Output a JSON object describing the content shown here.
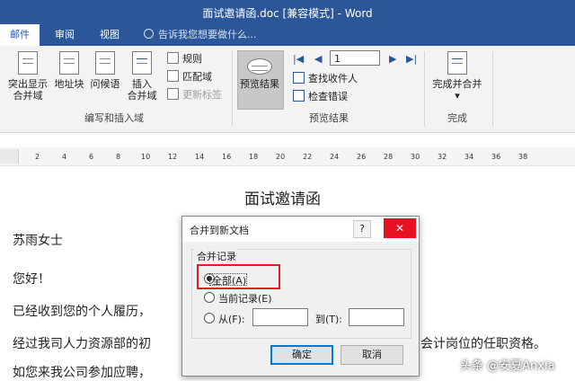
{
  "window": {
    "title": "面试邀请函.doc [兼容模式] - Word"
  },
  "tabs": [
    "邮件",
    "审阅",
    "视图"
  ],
  "tell_me": "告诉我您想要做什么...",
  "ribbon": {
    "highlight_merge_fields": [
      "突出显示",
      "合并域"
    ],
    "address_block": "地址块",
    "greeting_line": "问候语",
    "insert_merge_field": [
      "插入",
      "合并域"
    ],
    "rules": "规则",
    "match_fields": "匹配域",
    "update_labels": "更新标签",
    "group_write_insert": "编写和插入域",
    "preview_results": "预览结果",
    "record_number": "1",
    "find_recipient": "查找收件人",
    "check_errors": "检查错误",
    "group_preview": "预览结果",
    "finish_merge": "完成并合并",
    "group_finish": "完成"
  },
  "ruler": [
    "2",
    "4",
    "6",
    "8",
    "10",
    "12",
    "14",
    "16",
    "18",
    "20",
    "22",
    "24",
    "26",
    "28",
    "30",
    "32",
    "34",
    "36",
    "38"
  ],
  "document": {
    "title": "面试邀请函",
    "lines": [
      "苏雨女士",
      "您好！",
      "已经收到您的个人履历，",
      "经过我司人力资源部的初",
      "会计岗位的任职资格。",
      "如您来我公司参加应聘，"
    ]
  },
  "dialog": {
    "title": "合并到新文档",
    "help": "?",
    "close": "✕",
    "group": "合并记录",
    "all": "全部(A)",
    "current": "当前记录(E)",
    "from": "从(F):",
    "to": "到(T):",
    "from_value": "",
    "to_value": "",
    "ok": "确定",
    "cancel": "取消"
  },
  "watermark": "头条 @安夏Anxia"
}
